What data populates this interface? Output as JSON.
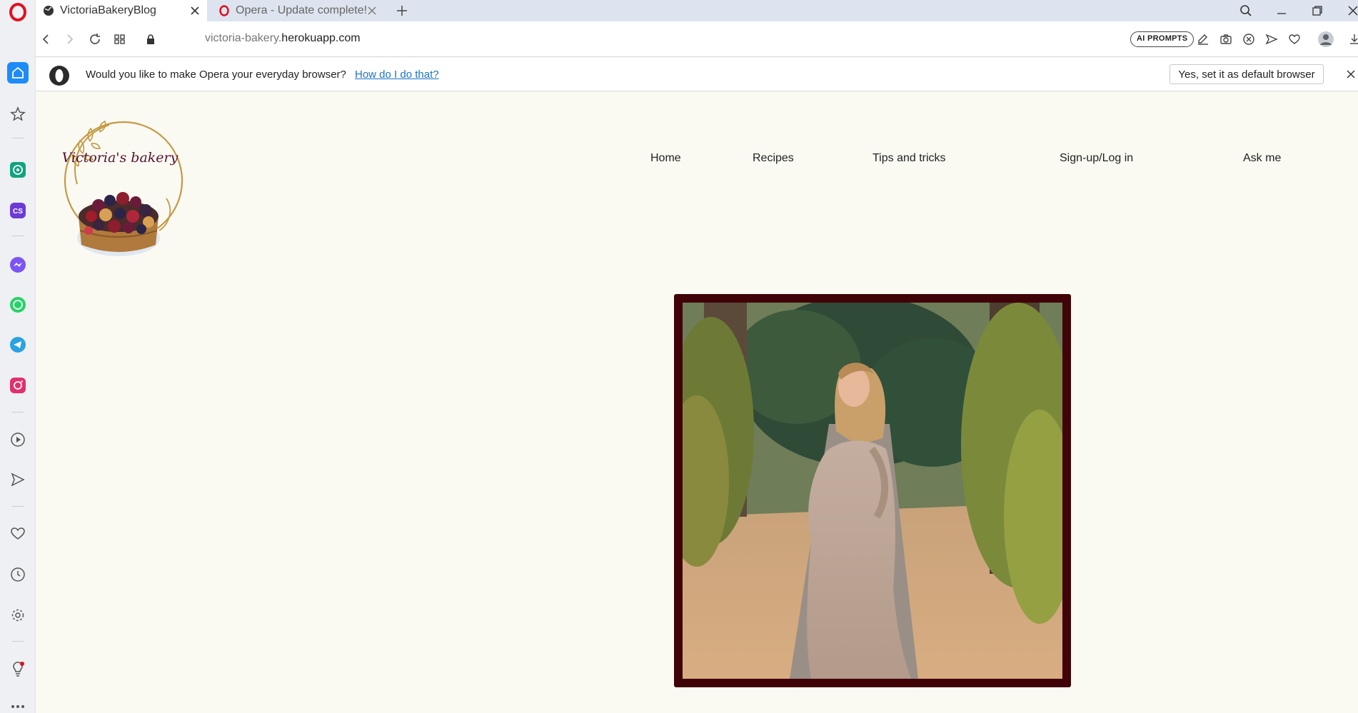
{
  "browser": {
    "tabs": [
      {
        "title": "VictoriaBakeryBlog",
        "active": true
      },
      {
        "title": "Opera - Update complete!",
        "active": false
      }
    ],
    "address": {
      "url_prefix": "victoria-bakery.",
      "url_host": "herokuapp.com"
    },
    "ai_prompts_label": "AI PROMPTS"
  },
  "banner": {
    "message": "Would you like to make Opera your everyday browser?",
    "link": "How do I do that?",
    "button": "Yes, set it as default browser"
  },
  "site": {
    "logo_text": "Victoria's bakery",
    "nav": [
      {
        "label": "Home"
      },
      {
        "label": "Recipes"
      },
      {
        "label": "Tips and tricks"
      },
      {
        "label": "Sign-up/Log in"
      },
      {
        "label": "Ask me"
      }
    ],
    "colors": {
      "accent": "#4a0508",
      "frame": "#3f0308",
      "background": "#fafaf3"
    }
  },
  "icons": {
    "sidebar": [
      "opera-logo-icon",
      "home-icon",
      "star-icon",
      "chatgpt-icon",
      "chatsonic-icon",
      "messenger-icon",
      "whatsapp-icon",
      "telegram-icon",
      "instagram-icon",
      "player-icon",
      "send-icon",
      "heart-icon",
      "history-icon",
      "settings-icon",
      "lightbulb-icon",
      "more-icon"
    ]
  }
}
